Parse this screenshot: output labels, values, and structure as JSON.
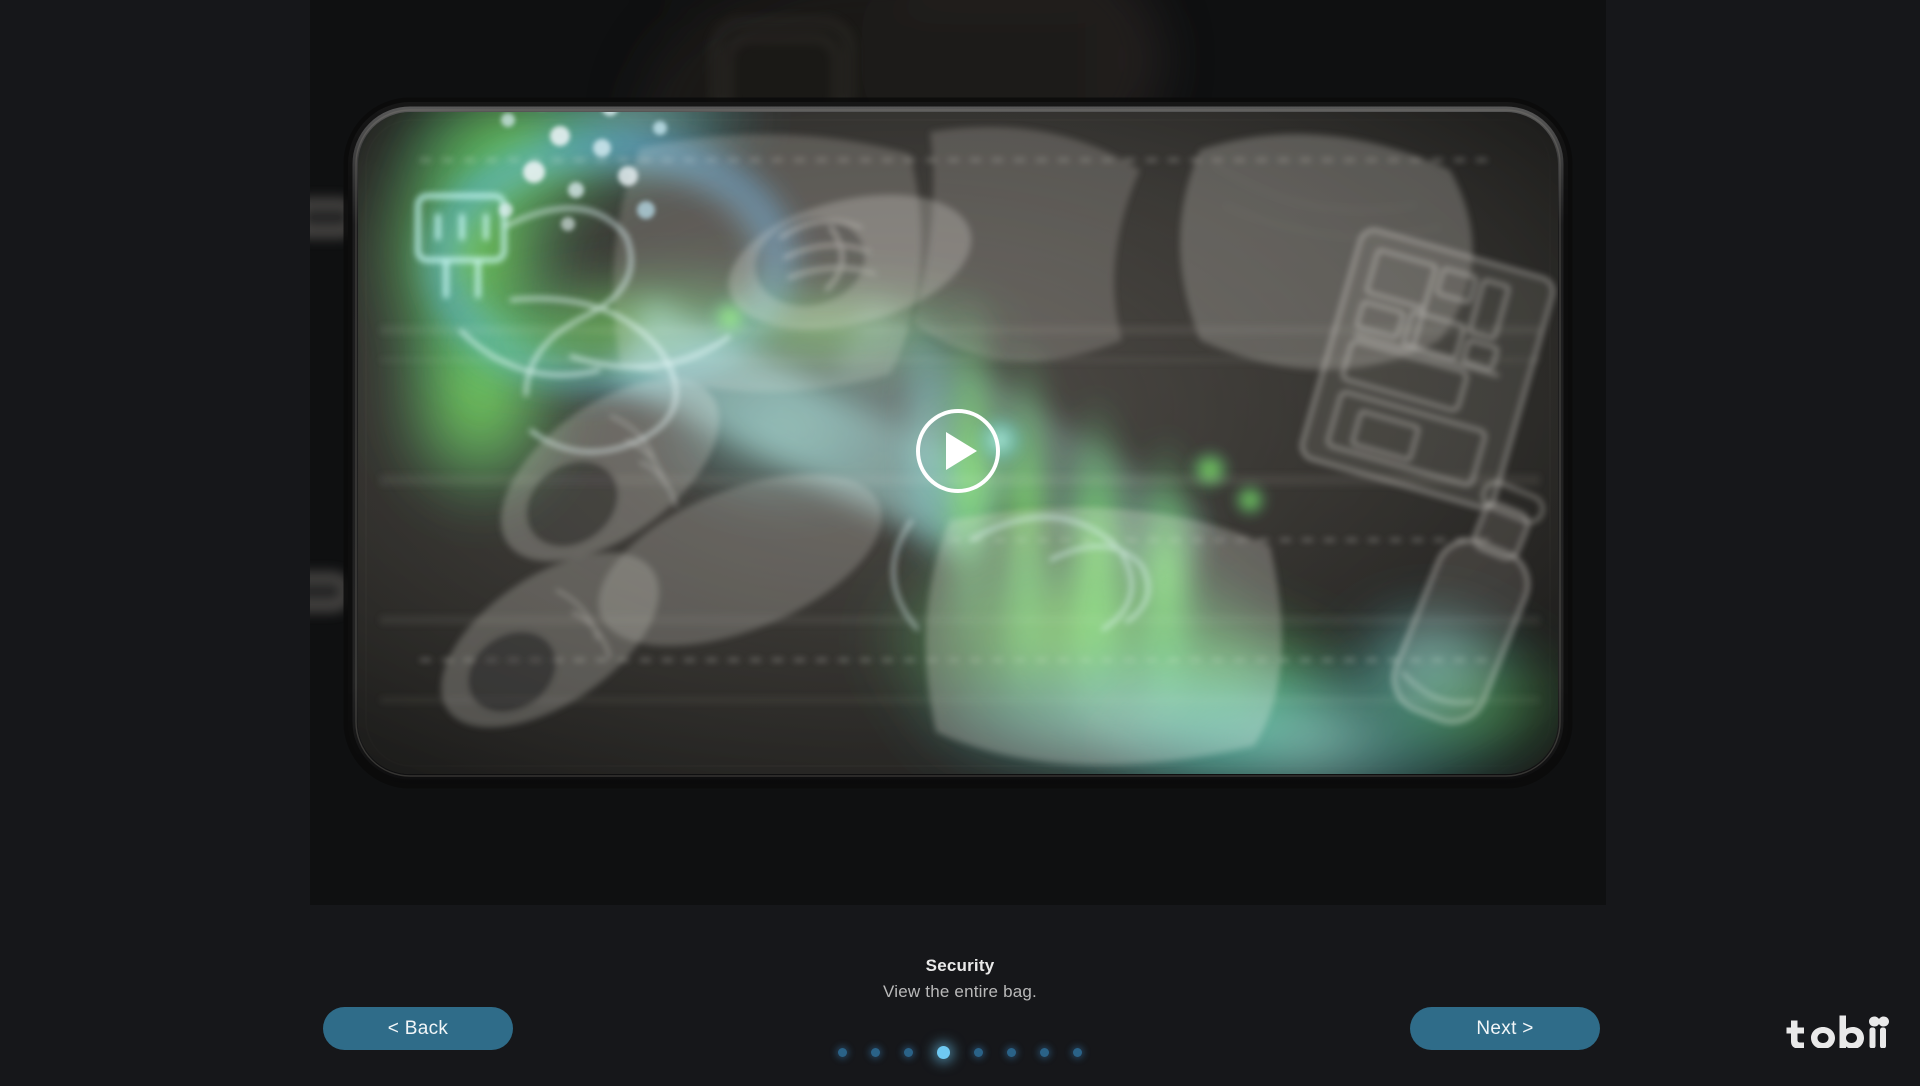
{
  "app": {
    "background_color": "#16171a",
    "accent_color": "#2f6c89",
    "active_dot_color": "#6fc9f2"
  },
  "media": {
    "name": "security-xray-bag-scan",
    "kind": "video",
    "state": "paused",
    "play_icon": "play-icon",
    "description": "X-ray scan of a packed suitcase with a gaze heat-map overlay",
    "heatmap": {
      "legend_hint": "gaze intensity",
      "colors": [
        "#3da0e0",
        "#55d6c0",
        "#6ee24a",
        "#bff5d4"
      ]
    },
    "xray_objects": [
      "suitcase-shell",
      "suitcase-handle",
      "caster-wheel-top-left",
      "caster-wheel-bottom-left",
      "power-adapter-plug",
      "cables",
      "sneaker-left",
      "sneaker-right",
      "folded-shirt",
      "tablet-circuit-board",
      "toiletry-bag",
      "spray-bottle"
    ]
  },
  "caption": {
    "title": "Security",
    "subtitle": "View the entire bag."
  },
  "footer": {
    "back_label": "< Back",
    "next_label": "Next >",
    "logo_text": "tobii"
  },
  "pagination": {
    "total": 8,
    "active_index": 3,
    "dots": [
      {
        "label": "Slide 1",
        "active": false
      },
      {
        "label": "Slide 2",
        "active": false
      },
      {
        "label": "Slide 3",
        "active": false
      },
      {
        "label": "Slide 4",
        "active": true
      },
      {
        "label": "Slide 5",
        "active": false
      },
      {
        "label": "Slide 6",
        "active": false
      },
      {
        "label": "Slide 7",
        "active": false
      },
      {
        "label": "Slide 8",
        "active": false
      }
    ]
  }
}
